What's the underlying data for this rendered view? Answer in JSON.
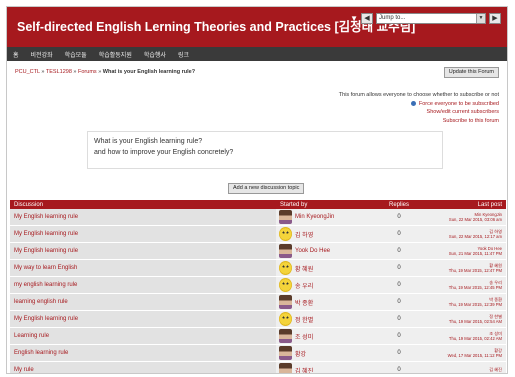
{
  "header": {
    "title": "Self-directed English Lerning Theories and Practices [김정태 교수님]",
    "jump_label": "Jump to..."
  },
  "menu": [
    "홈",
    "비전강좌",
    "학습모듈",
    "학습활동지원",
    "학습행사",
    "링크"
  ],
  "breadcrumb": {
    "root": "PCU_CTL",
    "sep1": "»",
    "course": "TESL1298",
    "sep2": "»",
    "section": "Forums",
    "sep3": "»",
    "current": "What is your English learning rule?"
  },
  "update_button": "Update this Forum",
  "subscription": {
    "info": "This forum allows everyone to choose whether to subscribe or not",
    "force": "Force everyone to be subscribed",
    "show_edit": "Show/edit current subscribers",
    "subscribe": "Subscribe to this forum"
  },
  "intro": {
    "line1": "What is your English learning rule?",
    "line2": "and how to improve your English concretely?"
  },
  "add_topic_button": "Add a new discussion topic",
  "table": {
    "headers": {
      "discussion": "Discussion",
      "started_by": "Started by",
      "replies": "Replies",
      "last_post": "Last post"
    },
    "rows": [
      {
        "topic": "My English learning rule",
        "author": "Min KyeongJin",
        "avatar": "photo",
        "replies": "0",
        "last_by": "Min KyeongJin",
        "last_date": "Sun, 22 Mar 2015, 03:06 am"
      },
      {
        "topic": "My English learning rule",
        "author": "김 하영",
        "avatar": "smile",
        "replies": "0",
        "last_by": "김 하영",
        "last_date": "Sun, 22 Mar 2015, 12:17 am"
      },
      {
        "topic": "My English learning rule",
        "author": "Yook Do Hee",
        "avatar": "photo",
        "replies": "0",
        "last_by": "Yook Do Hee",
        "last_date": "Sun, 21 Mar 2015, 11:47 PM"
      },
      {
        "topic": "My way to learn English",
        "author": "황 혜원",
        "avatar": "smile",
        "replies": "0",
        "last_by": "황 혜원",
        "last_date": "Thu, 19 Mar 2015, 12:47 PM"
      },
      {
        "topic": "my english learning rule",
        "author": "송 우리",
        "avatar": "smile",
        "replies": "0",
        "last_by": "송 우리",
        "last_date": "Thu, 19 Mar 2015, 12:45 PM"
      },
      {
        "topic": "learning english rule",
        "author": "박 종환",
        "avatar": "photo",
        "replies": "0",
        "last_by": "박 종환",
        "last_date": "Thu, 19 Mar 2015, 12:39 PM"
      },
      {
        "topic": "My English learning rule",
        "author": "정 한별",
        "avatar": "smile",
        "replies": "0",
        "last_by": "정 한별",
        "last_date": "Thu, 19 Mar 2015, 02:54 AM"
      },
      {
        "topic": "Learning rule",
        "author": "조 성미",
        "avatar": "photo",
        "replies": "0",
        "last_by": "조 성미",
        "last_date": "Thu, 19 Mar 2015, 02:42 AM"
      },
      {
        "topic": "English learning rule",
        "author": "황강",
        "avatar": "photo",
        "replies": "0",
        "last_by": "황강",
        "last_date": "Wed, 17 Mar 2015, 11:12 PM"
      },
      {
        "topic": "My rule",
        "author": "김 혜진",
        "avatar": "photo",
        "replies": "0",
        "last_by": "김 혜진",
        "last_date": ""
      }
    ]
  }
}
